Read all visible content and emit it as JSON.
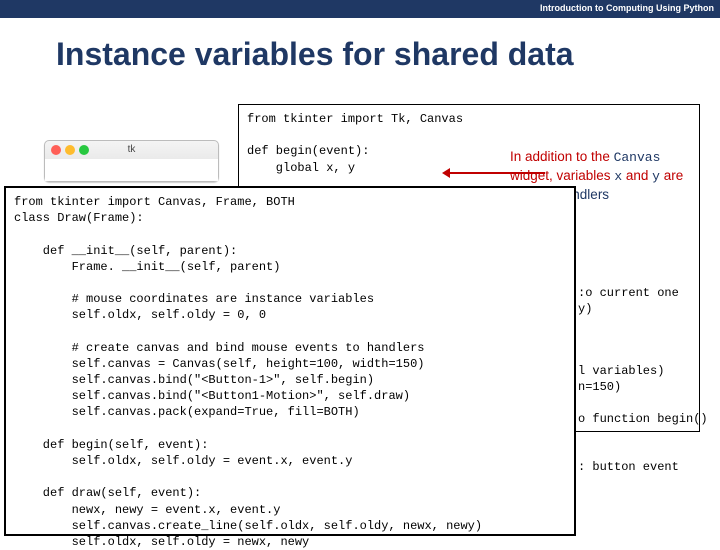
{
  "header": {
    "course": "Introduction to Computing Using Python"
  },
  "title": "Instance variables for shared data",
  "sidenote": {
    "line1_pre": "In addition to the ",
    "line1_code": "Canvas",
    "line2_pre": "widget, variables ",
    "line2_x": "x",
    "line2_mid": " and ",
    "line2_y": "y",
    "line2_post": " are",
    "line3": "y event handlers"
  },
  "peek": {
    "l1": ":o current one",
    "l2": "y)",
    "l3": "l variables)",
    "l4": "n=150)",
    "l5": "o function begin()",
    "l6": ": button event"
  },
  "code_top": "from tkinter import Tk, Canvas\n\ndef begin(event):\n    global x, y",
  "code_front": "from tkinter import Canvas, Frame, BOTH\nclass Draw(Frame):\n\n    def __init__(self, parent):\n        Frame. __init__(self, parent)\n\n        # mouse coordinates are instance variables\n        self.oldx, self.oldy = 0, 0\n\n        # create canvas and bind mouse events to handlers\n        self.canvas = Canvas(self, height=100, width=150)\n        self.canvas.bind(\"<Button-1>\", self.begin)\n        self.canvas.bind(\"<Button1-Motion>\", self.draw)\n        self.canvas.pack(expand=True, fill=BOTH)\n\n    def begin(self, event):\n        self.oldx, self.oldy = event.x, event.y\n\n    def draw(self, event):\n        newx, newy = event.x, event.y\n        self.canvas.create_line(self.oldx, self.oldy, newx, newy)\n        self.oldx, self.oldy = newx, newy",
  "tkwin": {
    "title": "tk"
  }
}
